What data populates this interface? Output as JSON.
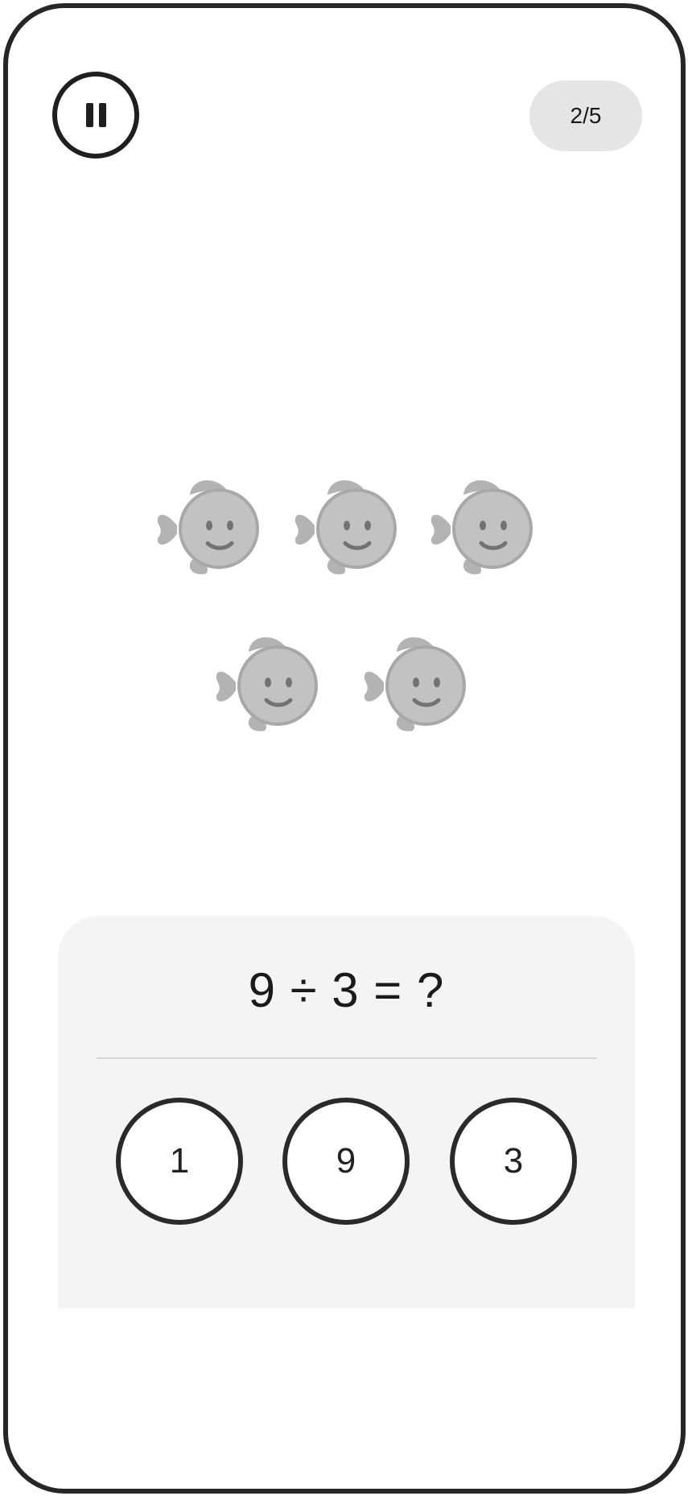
{
  "header": {
    "pause_icon": "pause-icon",
    "progress": "2/5"
  },
  "illustration": {
    "item_icon": "smiling-fish-icon",
    "item_count": 5,
    "fish_color": "#c2c2c2",
    "fin_color": "#b3b3b3",
    "face_color": "#737373"
  },
  "question": {
    "text": "9 ÷ 3 = ?",
    "answers": [
      "1",
      "9",
      "3"
    ]
  },
  "colors": {
    "frame": "#262626",
    "card_background": "#f4f4f4",
    "pill_background": "#e5e5e5"
  }
}
